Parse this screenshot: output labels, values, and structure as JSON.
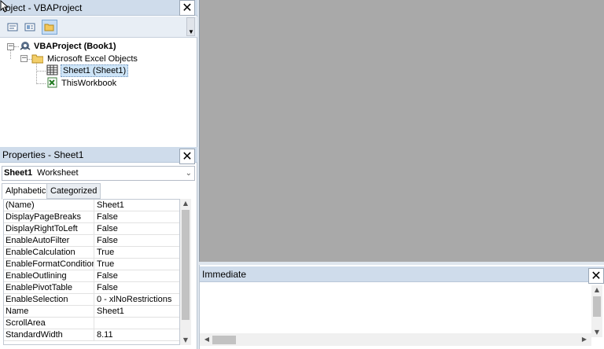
{
  "project_panel": {
    "title": "roject - VBAProject",
    "close_glyph": "✕",
    "toolbar": [
      {
        "name": "view-code-icon",
        "active": false
      },
      {
        "name": "view-object-icon",
        "active": false
      },
      {
        "name": "toggle-folders-icon",
        "active": true
      }
    ],
    "tree": {
      "root": {
        "label": "VBAProject (Book1)",
        "expander": "−"
      },
      "folder": {
        "label": "Microsoft Excel Objects",
        "expander": "−"
      },
      "items": [
        {
          "label": "Sheet1 (Sheet1)",
          "selected": true
        },
        {
          "label": "ThisWorkbook",
          "selected": false
        }
      ]
    }
  },
  "properties_panel": {
    "title": "Properties - Sheet1",
    "object_select": {
      "name": "Sheet1",
      "type": "Worksheet"
    },
    "tabs": [
      {
        "label": "Alphabetic",
        "selected": true
      },
      {
        "label": "Categorized",
        "selected": false
      }
    ],
    "rows": [
      {
        "name": "(Name)",
        "value": "Sheet1"
      },
      {
        "name": "DisplayPageBreaks",
        "value": "False"
      },
      {
        "name": "DisplayRightToLeft",
        "value": "False"
      },
      {
        "name": "EnableAutoFilter",
        "value": "False"
      },
      {
        "name": "EnableCalculation",
        "value": "True"
      },
      {
        "name": "EnableFormatConditionsC",
        "value": "True"
      },
      {
        "name": "EnableOutlining",
        "value": "False"
      },
      {
        "name": "EnablePivotTable",
        "value": "False"
      },
      {
        "name": "EnableSelection",
        "value": "0 - xlNoRestrictions"
      },
      {
        "name": "Name",
        "value": "Sheet1"
      },
      {
        "name": "ScrollArea",
        "value": ""
      },
      {
        "name": "StandardWidth",
        "value": "8.11"
      }
    ]
  },
  "immediate_panel": {
    "title": "Immediate"
  },
  "glyphs": {
    "up": "▲",
    "down": "▼",
    "left": "◀",
    "right": "▶",
    "caret": "⌄"
  },
  "colors": {
    "title_bar": "#cfdceb",
    "workspace": "#a9a9a9",
    "selection": "#cde4f7"
  }
}
